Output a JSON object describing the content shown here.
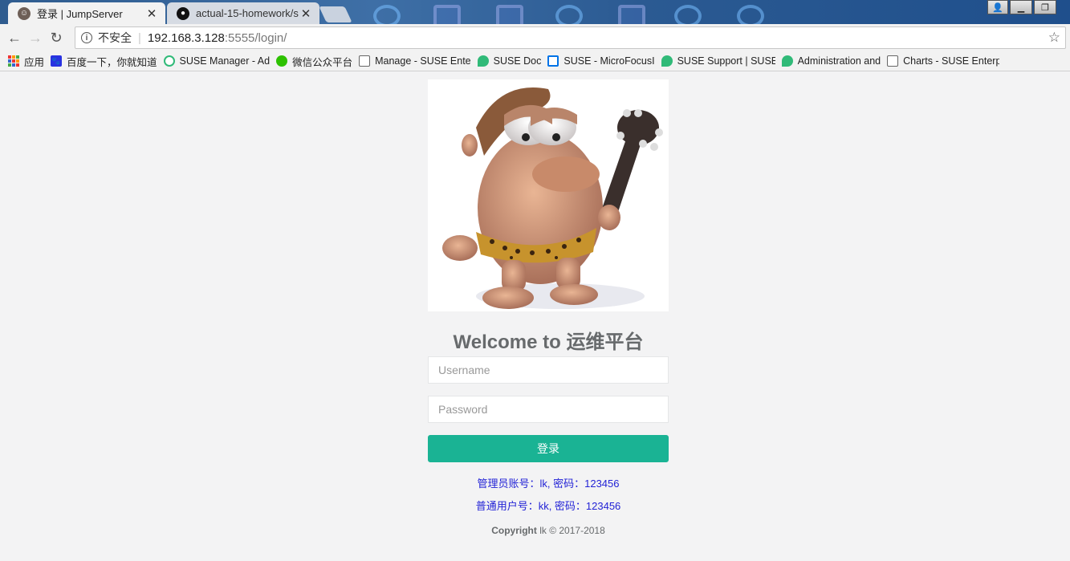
{
  "tabs": [
    {
      "title": "登录 | JumpServer",
      "active": true,
      "icon": "jumpserver-icon"
    },
    {
      "title": "actual-15-homework/s",
      "active": false,
      "icon": "github-icon"
    }
  ],
  "toolbar": {
    "insecure_label": "不安全",
    "url_host": "192.168.3.128",
    "url_path": ":5555/login/"
  },
  "bookmarks": [
    {
      "label": "应用",
      "icon": "apps-grid-icon"
    },
    {
      "label": "百度一下，你就知道",
      "icon": "baidu-icon"
    },
    {
      "label": "SUSE Manager - Ad",
      "icon": "suse-icon"
    },
    {
      "label": "微信公众平台",
      "icon": "wechat-icon"
    },
    {
      "label": "Manage - SUSE Ente",
      "icon": "document-icon"
    },
    {
      "label": "SUSE Doc",
      "icon": "suse-chat-icon"
    },
    {
      "label": "SUSE - MicroFocusI",
      "icon": "microfocus-icon"
    },
    {
      "label": "SUSE Support | SUSE",
      "icon": "suse-chat-icon"
    },
    {
      "label": "Administration and",
      "icon": "suse-chat-icon"
    },
    {
      "label": "Charts - SUSE Enterp",
      "icon": "document-icon"
    }
  ],
  "login": {
    "welcome": "Welcome to 运维平台",
    "username_placeholder": "Username",
    "password_placeholder": "Password",
    "submit_label": "登录",
    "hint_admin": "管理员账号：lk, 密码：123456",
    "hint_user": "普通用户号：kk, 密码：123456",
    "copyright_bold": "Copyright",
    "copyright_rest": " lk © 2017-2018"
  },
  "colors": {
    "accent": "#1ab394",
    "hint": "#2323d6",
    "page_bg": "#f3f3f4"
  }
}
